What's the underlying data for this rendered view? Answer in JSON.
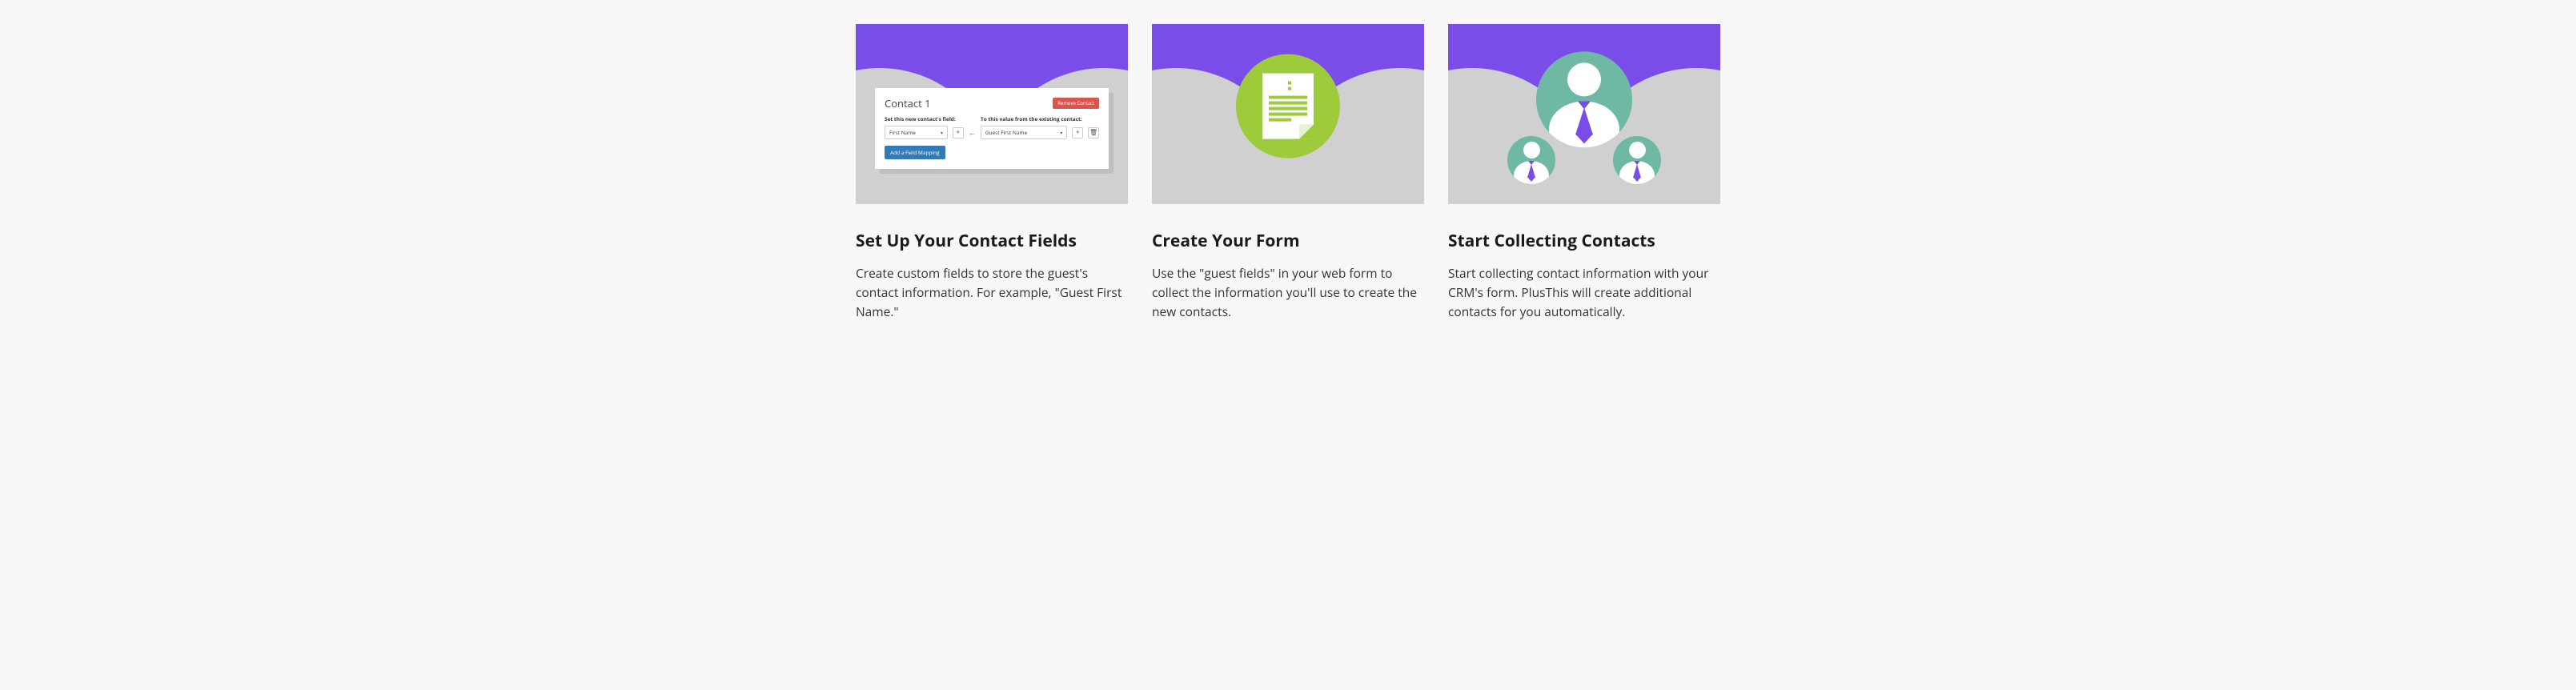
{
  "cards": [
    {
      "title": "Set Up Your Contact Fields",
      "body": "Create custom fields to store the guest's contact information. For example, \"Guest First Name.\"",
      "mock": {
        "heading": "Contact 1",
        "remove_label": "Remove Contact",
        "label_left": "Set this new contact's field:",
        "label_right": "To this value from the existing contact:",
        "select_left": "First Name",
        "select_right": "Guest First Name",
        "add_mapping_label": "Add a Field Mapping"
      }
    },
    {
      "title": "Create Your Form",
      "body": "Use the \"guest fields\" in your web form to collect the information you'll use to create the new contacts."
    },
    {
      "title": "Start Collecting Contacts",
      "body": "Start collecting contact information with your CRM's form. PlusThis will create additional contacts for you automatically."
    }
  ]
}
